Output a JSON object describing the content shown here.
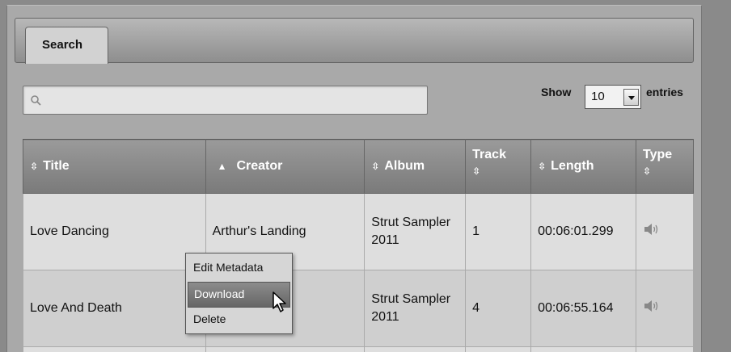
{
  "tabs": [
    {
      "label": "Search"
    }
  ],
  "search": {
    "value": "",
    "placeholder": ""
  },
  "paging": {
    "show_label": "Show",
    "page_size": "10",
    "entries_label": "entries"
  },
  "table": {
    "columns": [
      {
        "label": "Title",
        "sort": "both"
      },
      {
        "label": "Creator",
        "sort": "asc"
      },
      {
        "label": "Album",
        "sort": "both"
      },
      {
        "label": "Track",
        "sort": "both"
      },
      {
        "label": "Length",
        "sort": "both"
      },
      {
        "label": "Type",
        "sort": "both"
      }
    ],
    "rows": [
      {
        "title": "Love Dancing",
        "creator": "Arthur's Landing",
        "album": "Strut Sampler 2011",
        "track": "1",
        "length": "00:06:01.299",
        "type_icon": "speaker-icon"
      },
      {
        "title": "Love And Death",
        "creator": "",
        "album": "Strut Sampler 2011",
        "track": "4",
        "length": "00:06:55.164",
        "type_icon": "speaker-icon"
      }
    ]
  },
  "context_menu": {
    "items": [
      {
        "label": "Edit Metadata"
      },
      {
        "label": "Download"
      },
      {
        "label": "Delete"
      }
    ],
    "highlighted": "Download"
  },
  "colors": {
    "background": "#8a8a8a",
    "header": "#808080",
    "row_even": "#dedede",
    "row_odd": "#cfcfcf",
    "menu_highlight": "#777777"
  }
}
